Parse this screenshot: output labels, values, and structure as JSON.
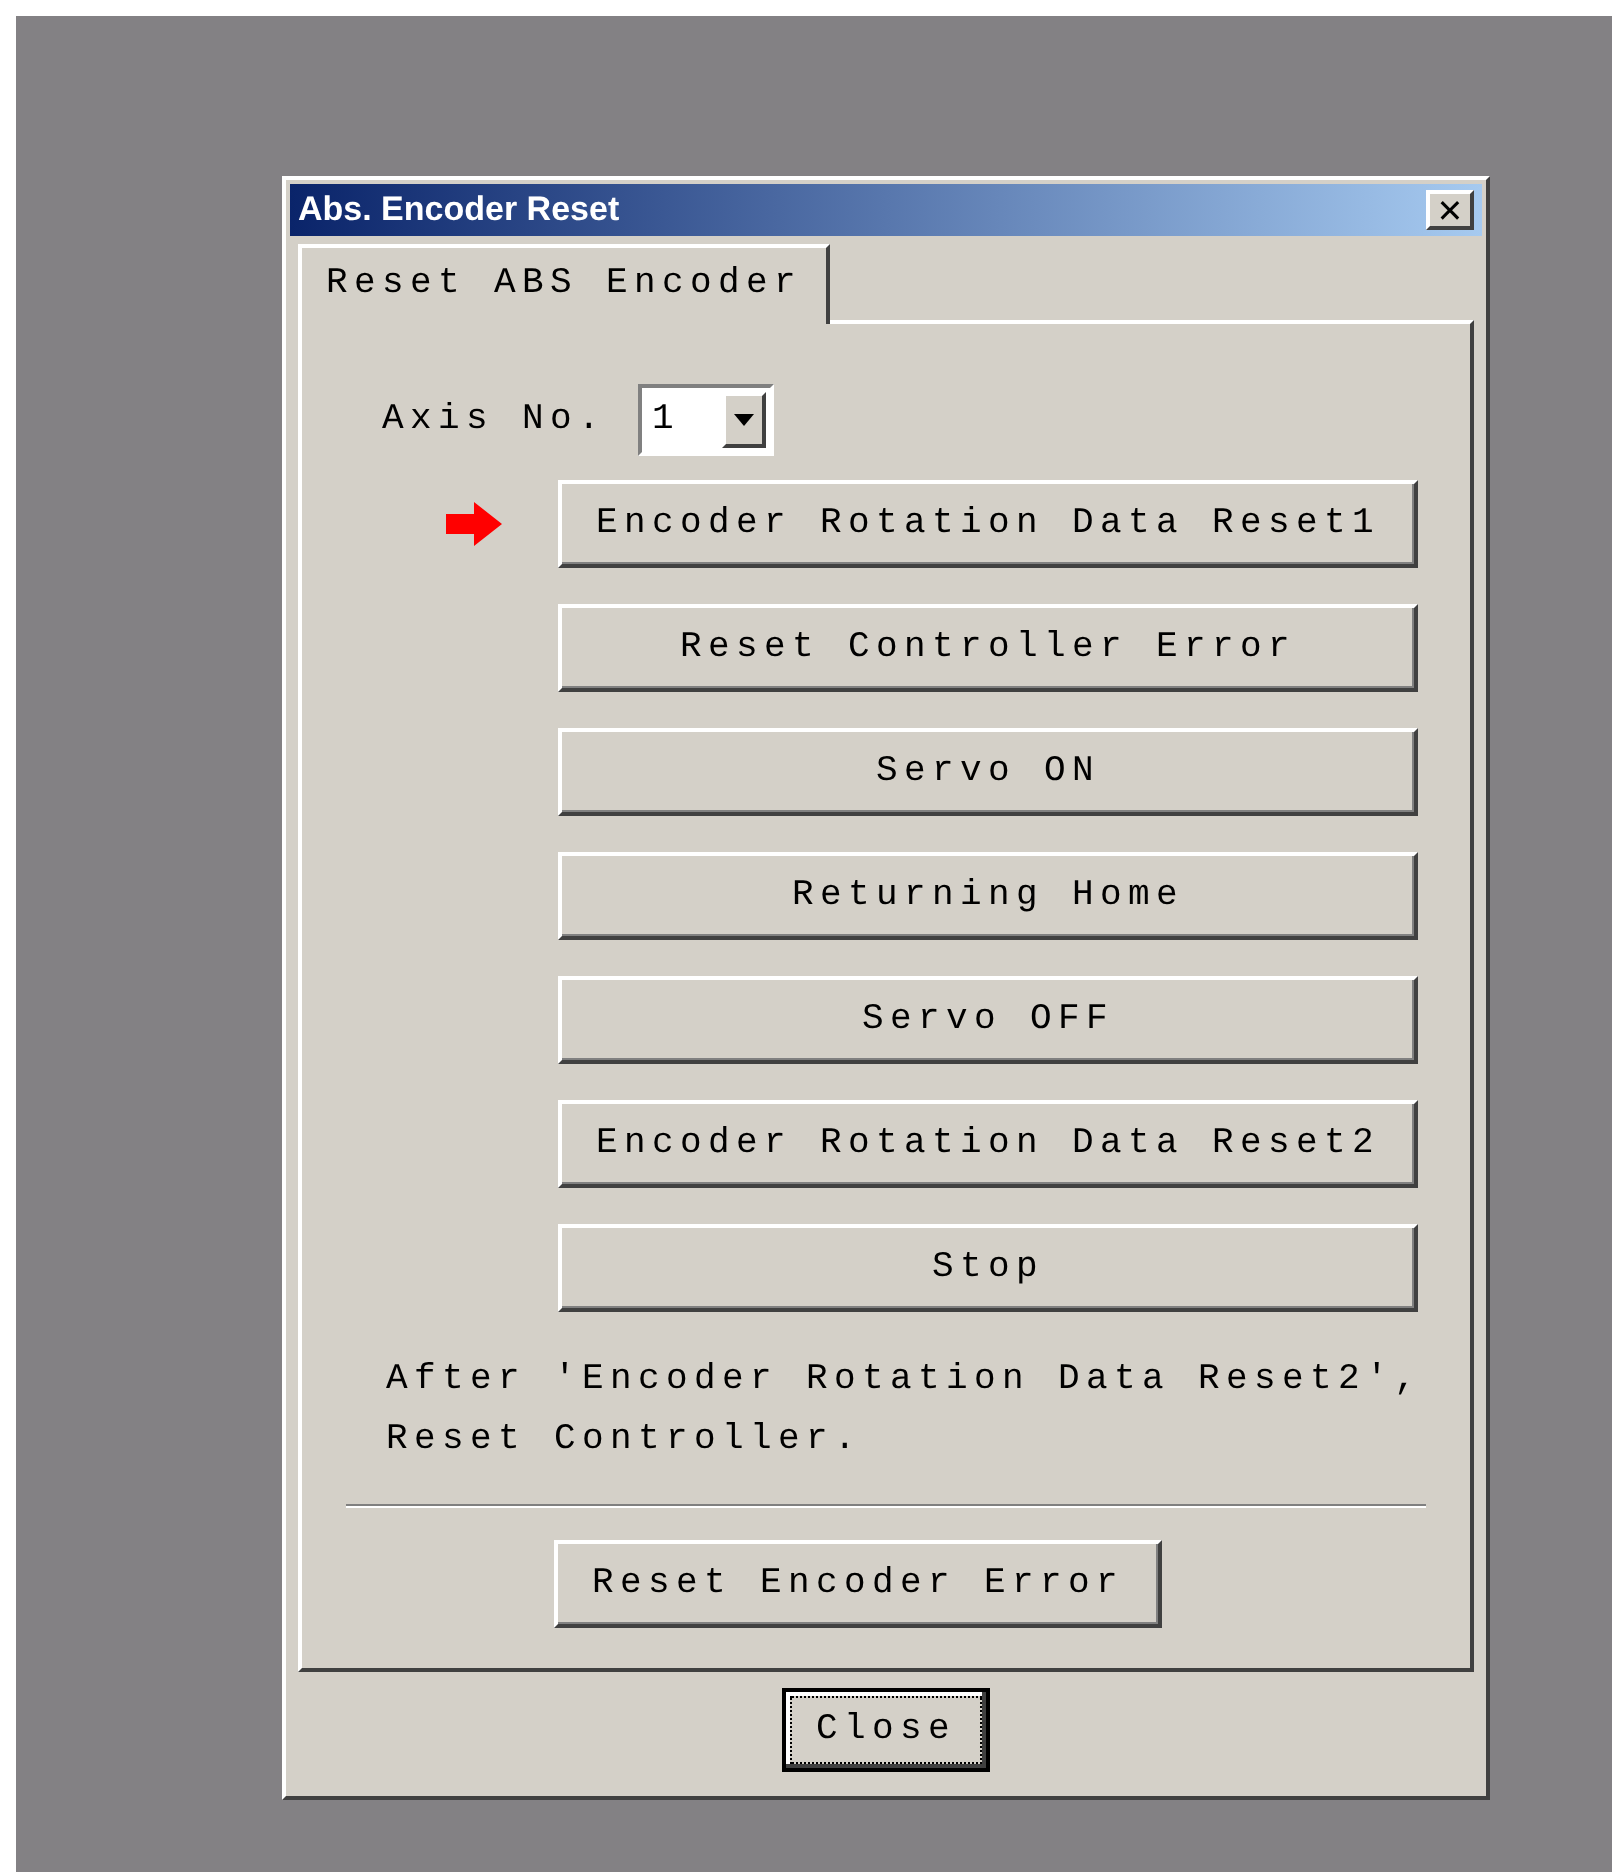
{
  "window": {
    "title": "Abs. Encoder Reset",
    "close_glyph": "✕"
  },
  "tabs": [
    {
      "label": "Reset ABS Encoder",
      "selected": true
    }
  ],
  "axis": {
    "label": "Axis No.",
    "value": "1"
  },
  "steps": [
    {
      "label": "Encoder Rotation Data Reset1",
      "current": true
    },
    {
      "label": "Reset Controller Error",
      "current": false
    },
    {
      "label": "Servo ON",
      "current": false
    },
    {
      "label": "Returning Home",
      "current": false
    },
    {
      "label": "Servo OFF",
      "current": false
    },
    {
      "label": "Encoder Rotation Data Reset2",
      "current": false
    },
    {
      "label": "Stop",
      "current": false
    }
  ],
  "note": [
    "After 'Encoder Rotation Data Reset2',",
    "Reset Controller."
  ],
  "extra_button": "Reset Encoder Error",
  "close_button": {
    "label": "Close",
    "focused": true
  }
}
